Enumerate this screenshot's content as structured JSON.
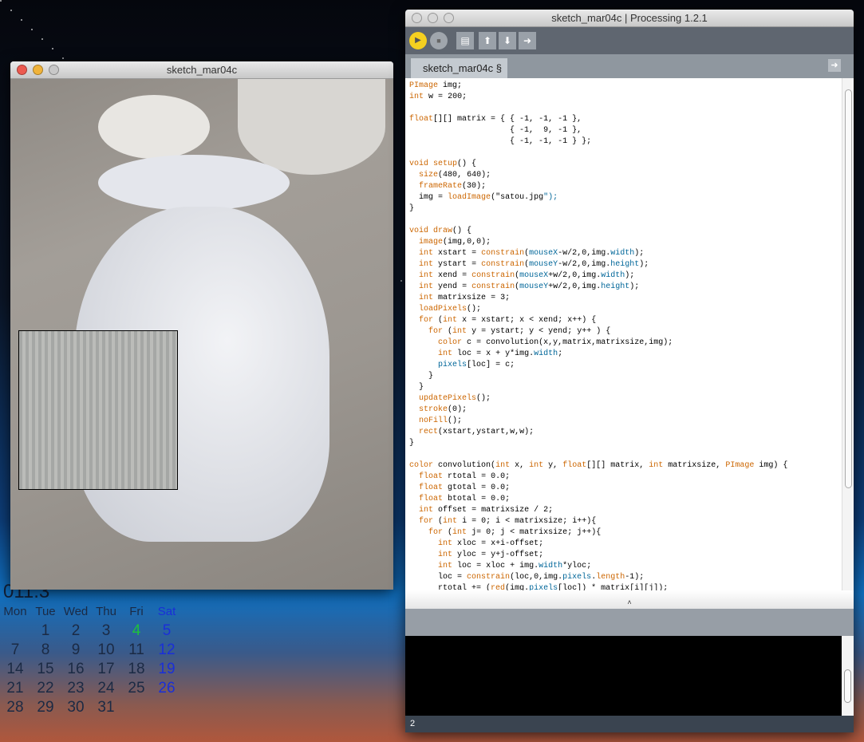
{
  "calendar": {
    "year_partial": "011.3",
    "days": [
      "Mon",
      "Tue",
      "Wed",
      "Thu",
      "Fri",
      "Sat"
    ],
    "weeks": [
      [
        "",
        "1",
        "2",
        "3",
        "4",
        "5"
      ],
      [
        "7",
        "8",
        "9",
        "10",
        "11",
        "12"
      ],
      [
        "14",
        "15",
        "16",
        "17",
        "18",
        "19"
      ],
      [
        "21",
        "22",
        "23",
        "24",
        "25",
        "26"
      ],
      [
        "28",
        "29",
        "30",
        "31",
        "",
        ""
      ]
    ],
    "today": "4",
    "colors": {
      "today": "#1fc23a",
      "sat": "#1a2fd8"
    }
  },
  "sketch_window": {
    "title": "sketch_mar04c"
  },
  "ide": {
    "title": "sketch_mar04c | Processing 1.2.1",
    "tab": "sketch_mar04c §",
    "status_line": "2",
    "toolbar": [
      "run",
      "stop",
      "new",
      "open",
      "save",
      "export"
    ],
    "code": [
      "PImage img;",
      "int w = 200;",
      "",
      "float[][] matrix = { { -1, -1, -1 },",
      "                     { -1,  9, -1 },",
      "                     { -1, -1, -1 } };",
      "",
      "void setup() {",
      "  size(480, 640);",
      "  frameRate(30);",
      "  img = loadImage(\"satou.jpg\");",
      "}",
      "",
      "void draw() {",
      "  image(img,0,0);",
      "  int xstart = constrain(mouseX-w/2,0,img.width);",
      "  int ystart = constrain(mouseY-w/2,0,img.height);",
      "  int xend = constrain(mouseX+w/2,0,img.width);",
      "  int yend = constrain(mouseY+w/2,0,img.height);",
      "  int matrixsize = 3;",
      "  loadPixels();",
      "  for (int x = xstart; x < xend; x++) {",
      "    for (int y = ystart; y < yend; y++ ) {",
      "      color c = convolution(x,y,matrix,matrixsize,img);",
      "      int loc = x + y*img.width;",
      "      pixels[loc] = c;",
      "    }",
      "  }",
      "  updatePixels();",
      "  stroke(0);",
      "  noFill();",
      "  rect(xstart,ystart,w,w);",
      "}",
      "",
      "color convolution(int x, int y, float[][] matrix, int matrixsize, PImage img) {",
      "  float rtotal = 0.0;",
      "  float gtotal = 0.0;",
      "  float btotal = 0.0;",
      "  int offset = matrixsize / 2;",
      "  for (int i = 0; i < matrixsize; i++){",
      "    for (int j= 0; j < matrixsize; j++){",
      "      int xloc = x+i-offset;",
      "      int yloc = y+j-offset;",
      "      int loc = xloc + img.width*yloc;",
      "      loc = constrain(loc,0,img.pixels.length-1);",
      "      rtotal += (red(img.pixels[loc]) * matrix[i][j]);"
    ],
    "keywords": [
      "PImage",
      "int",
      "float",
      "void",
      "color",
      "for",
      "setup",
      "draw",
      "size",
      "frameRate",
      "loadImage",
      "image",
      "constrain",
      "loadPixels",
      "updatePixels",
      "stroke",
      "noFill",
      "rect",
      "red",
      "length"
    ],
    "builtins": [
      "mouseX",
      "mouseY",
      "width",
      "height",
      "pixels"
    ]
  }
}
